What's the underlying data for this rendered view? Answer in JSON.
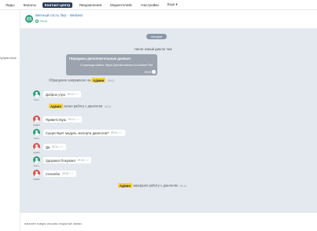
{
  "nav": {
    "items": [
      {
        "label": "Лиды"
      },
      {
        "label": "Каналы"
      },
      {
        "label": "Контакт-центр",
        "active": true
      },
      {
        "label": "Уведомления"
      },
      {
        "label": "Маркетплейс"
      },
      {
        "label": "Настройки"
      },
      {
        "label": "Еще ▾"
      }
    ]
  },
  "sidebar": {
    "text": "хулули ьные"
  },
  "chat_header": {
    "title": "Мятный гость №2 - Webest",
    "subtitle": "Гость"
  },
  "chat": {
    "date_badge": "сегодня",
    "new_dialog": "Начат новый диалог №4",
    "info": {
      "title": "Переданы дополнительные данные:",
      "row": "Страница сайта: https://portal.webest.ru/online/?IM",
      "time": "09:03"
    },
    "routed": {
      "text": "Обращение направлено на",
      "tag": "Админ",
      "time": "09:03"
    },
    "admin_started": {
      "tag": "Админ",
      "text": "начал работу с диалогом",
      "time": "09:13"
    },
    "finished": {
      "tag": "Админ",
      "text": "завершил работу с диалогом",
      "time": "09:16"
    },
    "messages": [
      {
        "who": "guest",
        "label": "Гость",
        "text": "Доброе утро",
        "time": "09:13"
      },
      {
        "who": "client",
        "label": "Админ",
        "text": "Приветствую",
        "time": "09:13"
      },
      {
        "who": "guest",
        "label": "Гость",
        "text": "Существует модуль экспорта диалогов?",
        "time": "09:14"
      },
      {
        "who": "client",
        "label": "Админ",
        "text": "Да",
        "time": "09:14"
      },
      {
        "who": "guest",
        "label": "Гость",
        "text": "Здорово! Покупаю!",
        "time": "09:15"
      },
      {
        "who": "client",
        "label": "Админ",
        "text": "Спасибо!",
        "time": "09:15"
      }
    ]
  },
  "footer": {
    "text": "начните новую сессию открытой линии"
  },
  "colors": {
    "accent": "#2d3f5c",
    "guest": "#2fa07a",
    "client": "#d9544f",
    "admin_tag": "#f4d33a",
    "chat_bg": "#e3e9ee"
  }
}
